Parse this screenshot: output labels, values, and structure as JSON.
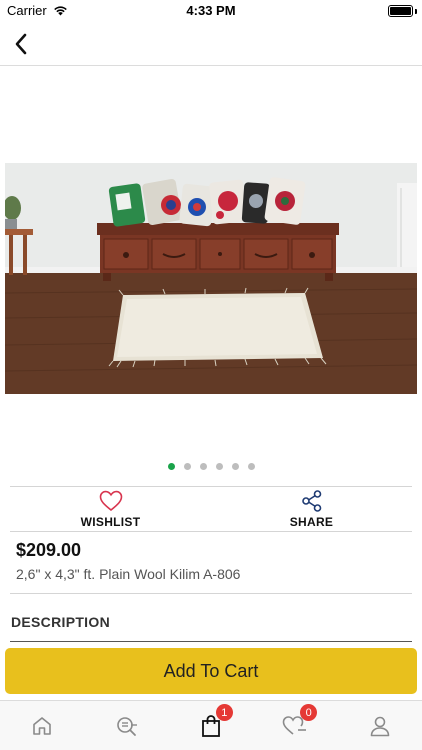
{
  "status": {
    "carrier": "Carrier",
    "time": "4:33 PM"
  },
  "gallery": {
    "page_count": 6,
    "active_page": 1
  },
  "actions": {
    "wishlist_label": "WISHLIST",
    "share_label": "SHARE"
  },
  "product": {
    "price": "$209.00",
    "name": "2,6\" x 4,3\" ft. Plain Wool Kilim A-806"
  },
  "description": {
    "header": "DESCRIPTION"
  },
  "cart_button": {
    "label": "Add To Cart"
  },
  "tab_bar": {
    "cart_badge": "1",
    "wishlist_badge": "0"
  },
  "colors": {
    "accent": "#e8c01d",
    "dot_active": "#1aa34a",
    "badge": "#e53935",
    "icon_blue": "#1f3b73",
    "heart": "#d8344e"
  }
}
